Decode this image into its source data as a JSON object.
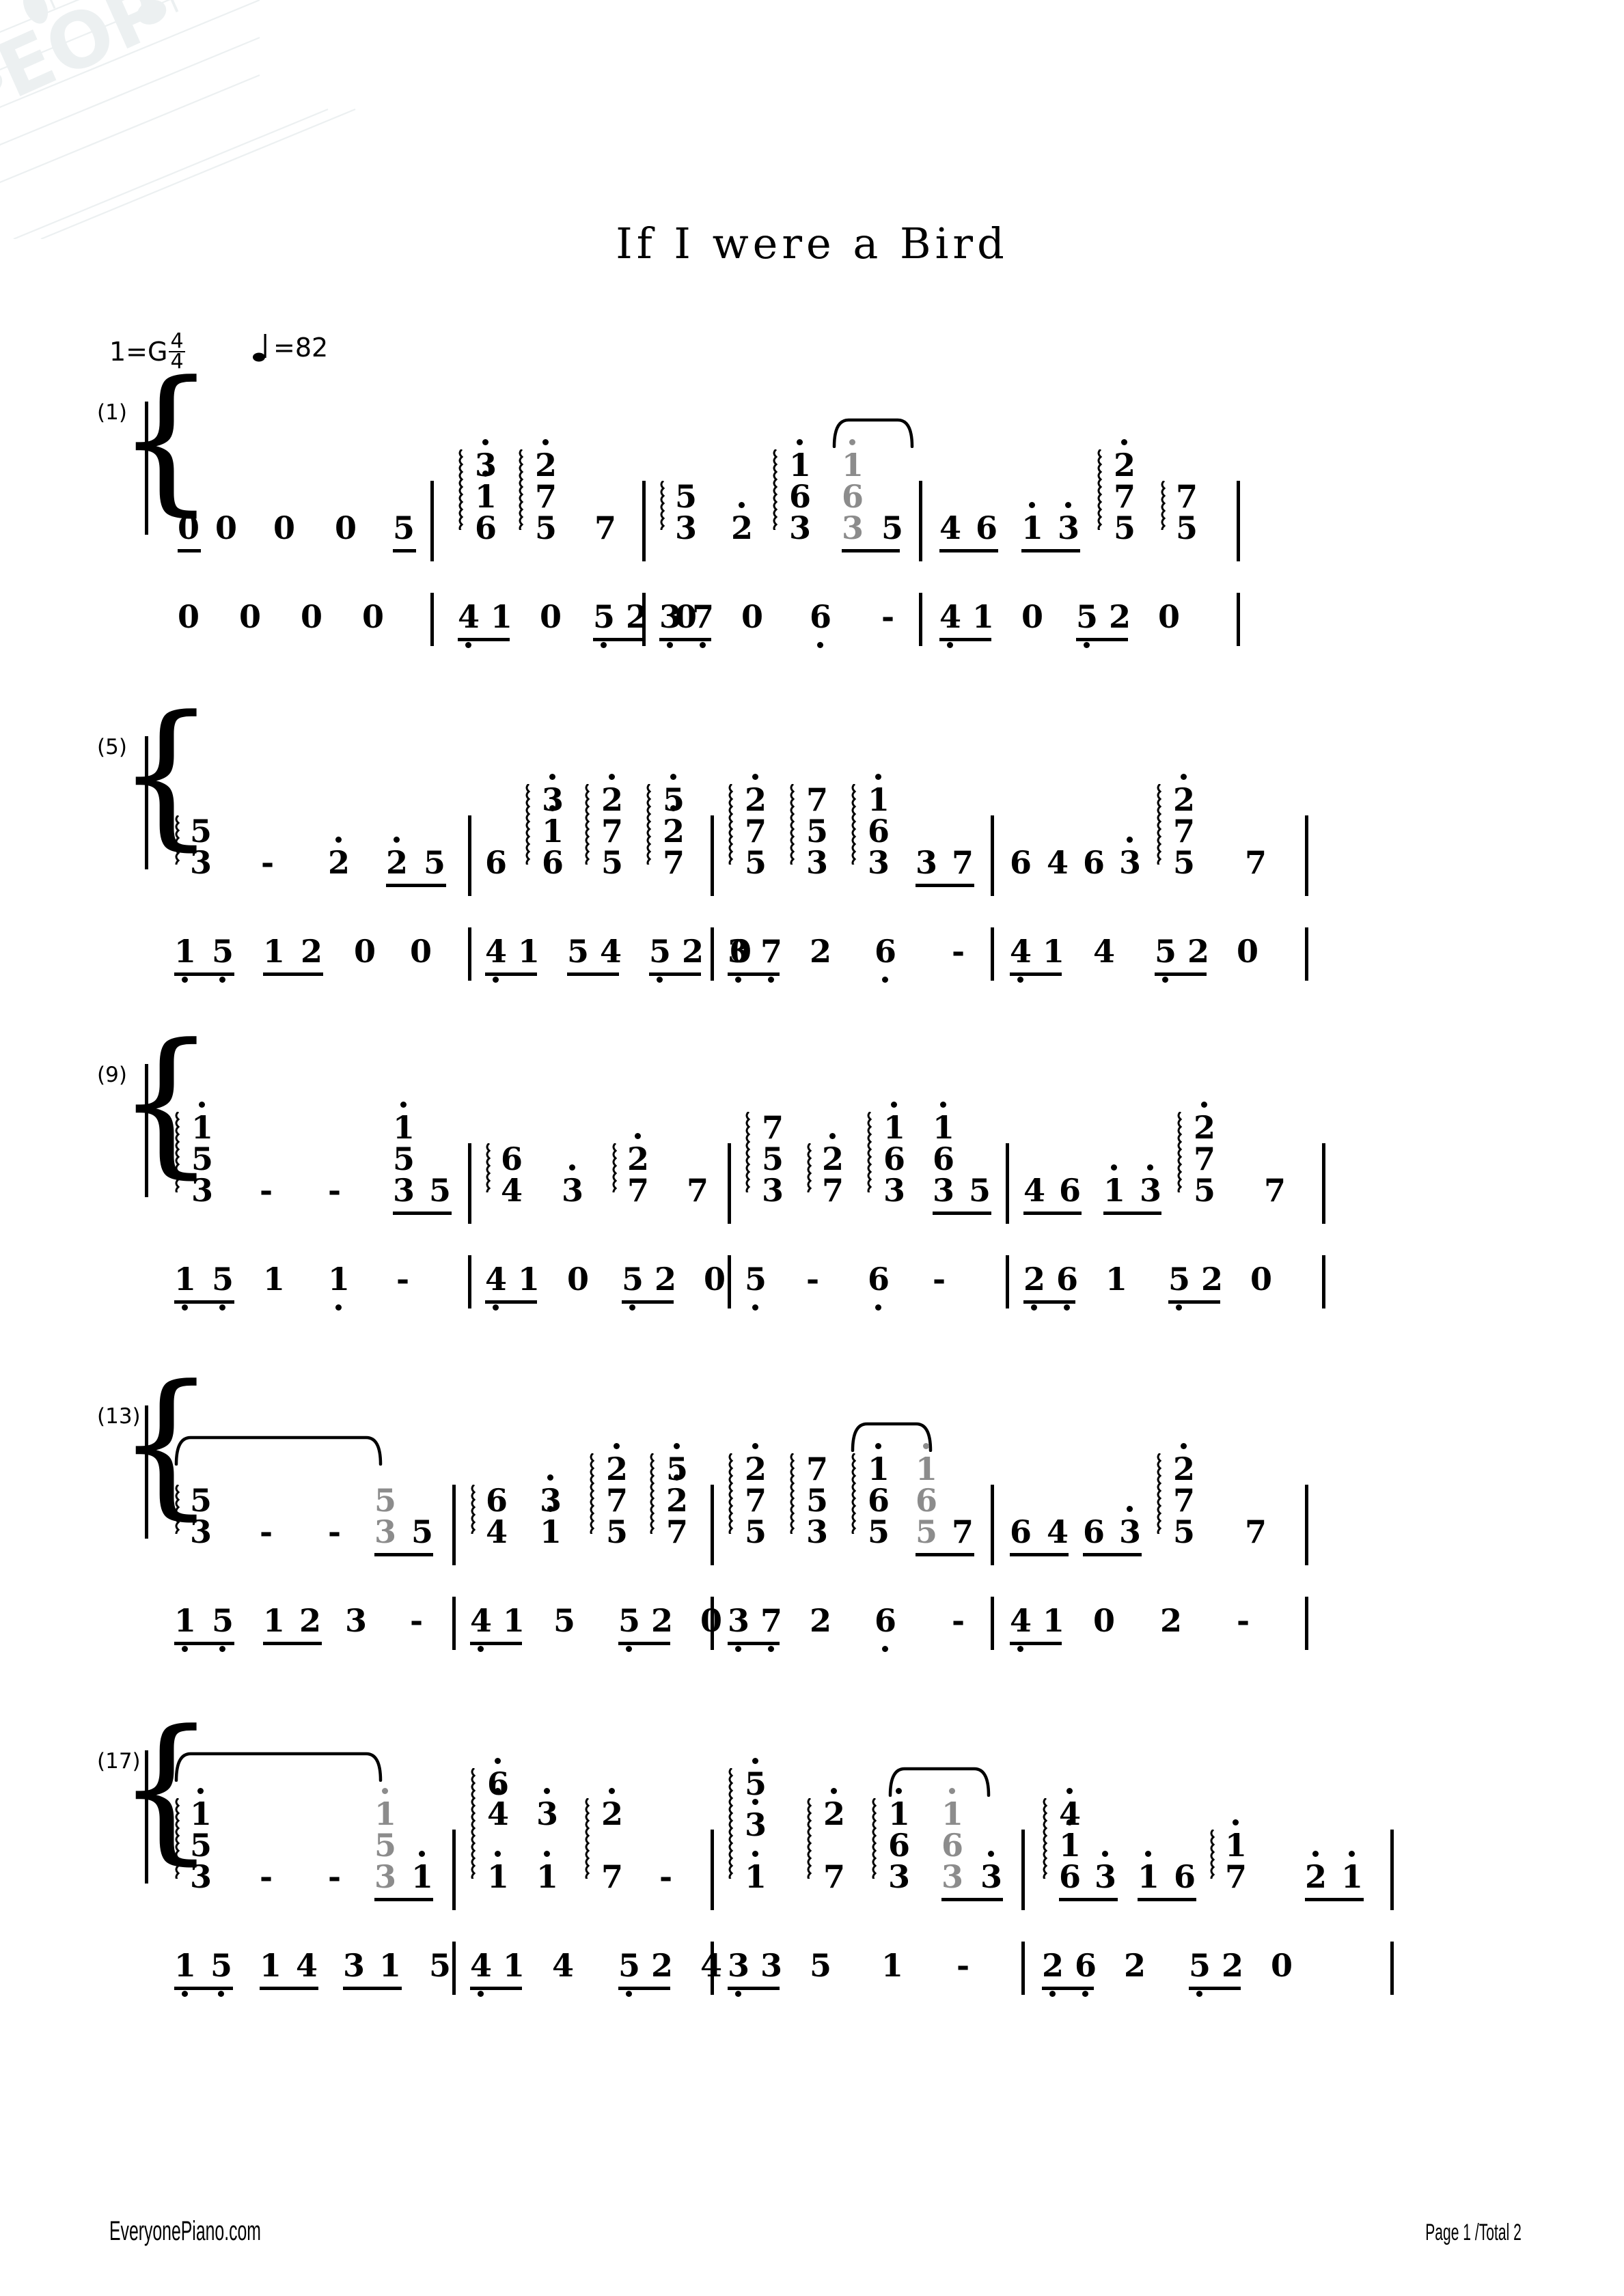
{
  "document": {
    "title": "If I were a Bird",
    "key_signature": "1=G",
    "time_signature_num": "4",
    "time_signature_den": "4",
    "tempo_label": "=82",
    "tempo_bpm": "82",
    "notation_type": "jianpu numbered notation",
    "watermark_text": "EOP"
  },
  "footer": {
    "site": "EveryonePiano.com",
    "page": "Page 1 /Total 2"
  },
  "systems": [
    {
      "measure_number": "(1)",
      "treble": "0 0  0  0  5 | 6  3/1/6  2/7/5  7 | 5/3  2.  1./6/3  1./6/3 5 | 4 6 1. 3.  2./7/5  7/5 |",
      "bass": "0  0  0  0 | 4 1 0  5 2 0 | 3 7 0  6. - | 4 1 0  5 2 0 |"
    },
    {
      "measure_number": "(5)",
      "treble": "5/3  -  2.  2. 5 | 6  3/1/6  2/7/5  5./2./7 | 2/7/5  7/5/3  1./6/3  3 7 | 6 4 6 3.  2./7/5  7 |",
      "bass": "1 5 1 2 0  0 | 4 1 5 4 5 2 0 | 3 7 2  6. - | 4 1 4  5 2 0 |"
    },
    {
      "measure_number": "(9)",
      "treble": "1./5/3  -  -  1./5 3 5 | 6/4  3.  2./7  7 | 7/5/3  2./7  1./6/3  3 5 | 4 6 1. 3.  2./7/5  7 |",
      "bass": "1 5 1  1. - | 4 1 0  5 2 0 | 5. -  6. - | 2 6 1  5 2 0 |"
    },
    {
      "measure_number": "(13)",
      "treble": "5/3  -  -  5/3 5 | 6/4  3./1.  2./7/5  5./2./7 | 2./7/5  7/5/3  1./6/5  6/5 7 | 6 4 6 3.  2./7/5  7 |",
      "bass": "1 5 1 2 3  - | 4 1 5  5 2 0 | 3 7 2  6. - | 4 1 0  2  - |"
    },
    {
      "measure_number": "(17)",
      "treble": "1./5/3  -  -  1./5/3 1. | 6./4./1.  3./1.  2./7/5  - | 5./3./1.  2./7  1./6/3  6/3 3. | 4./1./6 3. 1. 6  1./7  2. 1. |",
      "bass": "1 5 1 4 3 1 5 | 4 1 4  5 2 4 | 3 3 5  1  - | 2 6 2  5 2 0 |"
    }
  ],
  "symbols": {
    "arpeggio": "arpeggio-squiggle",
    "slur": "slur-tie-arc",
    "rest": "0",
    "sustain_dash": "-",
    "octave_up_dot": "dot-above",
    "octave_down_dot": "dot-below",
    "beam": "underline-beam"
  },
  "colors": {
    "ink": "#000000",
    "tied_note_gray": "#8c8c8c",
    "watermark": "#dde4e6"
  }
}
